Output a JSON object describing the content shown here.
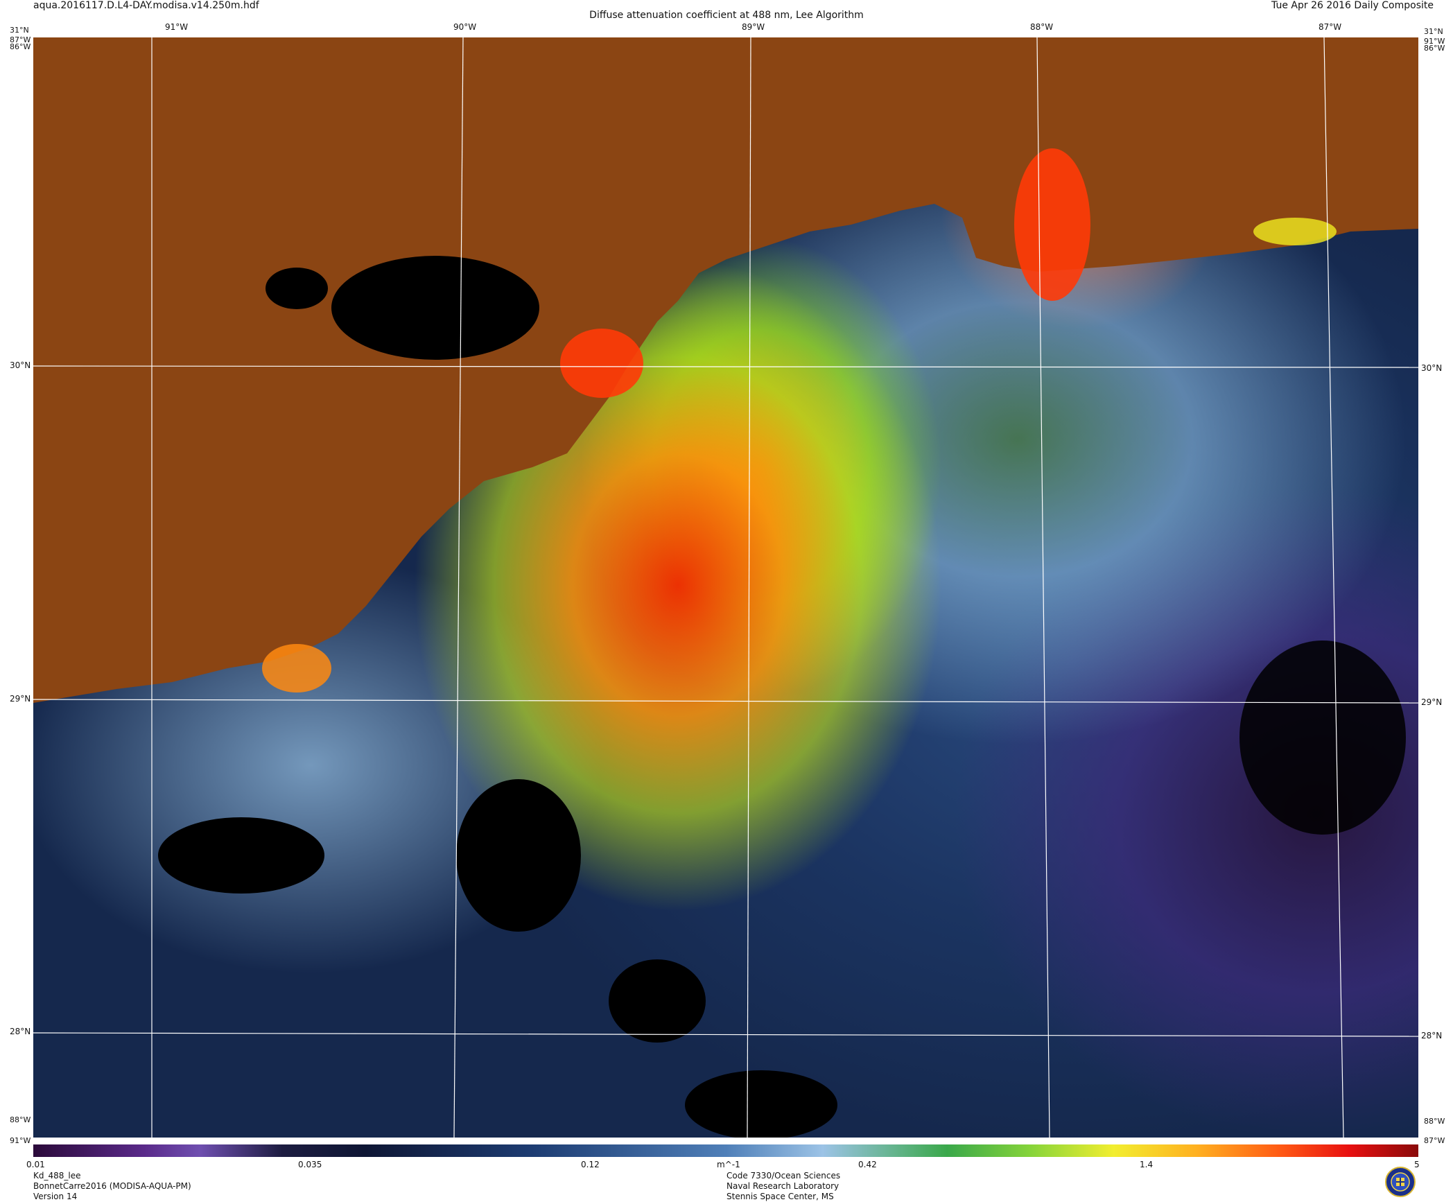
{
  "header": {
    "file_name": "aqua.2016117.D.L4-DAY.modisa.v14.250m.hdf",
    "product_title": "Diffuse attenuation coefficient at 488 nm, Lee Algorithm",
    "date_label": "Tue Apr 26 2016 Daily Composite"
  },
  "graticule": {
    "longitude_labels": [
      "91°W",
      "90°W",
      "89°W",
      "88°W",
      "87°W"
    ],
    "latitude_labels": [
      "30°N",
      "29°N",
      "28°N"
    ],
    "corner_labels": {
      "top_left_lat": "31°N",
      "top_left_lon_a": "87°W",
      "top_left_lon_b": "86°W",
      "top_right_lat": "31°N",
      "top_right_lon_a": "91°W",
      "top_right_lon_b": "86°W",
      "bottom_left_lon_a": "88°W",
      "bottom_left_lon_b": "91°W",
      "bottom_right_lon_a": "88°W",
      "bottom_right_lon_b": "87°W"
    }
  },
  "colorbar": {
    "unit": "m^-1",
    "ticks": [
      "0.01",
      "0.035",
      "0.12",
      "0.42",
      "1.4",
      "5"
    ],
    "tick_values": [
      0.01,
      0.035,
      0.12,
      0.42,
      1.4,
      5
    ],
    "scale": "log",
    "range": [
      0.01,
      5
    ]
  },
  "footer": {
    "left": [
      "Kd_488_lee",
      "BonnetCarre2016 (MODISA-AQUA-PM)",
      "Version 14"
    ],
    "center": [
      "Code 7330/Ocean Sciences",
      "Naval Research Laboratory",
      "Stennis Space Center, MS"
    ]
  },
  "colors": {
    "land": "#8b4513",
    "no_data": "#000000",
    "graticule": "#ffffff",
    "coastline": "#ffffff"
  },
  "icons": {
    "logo": "nrl-seal-icon"
  }
}
